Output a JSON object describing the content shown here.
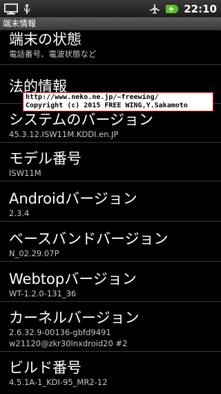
{
  "status_bar": {
    "time": "22:10",
    "icons": [
      "monitor-icon",
      "usb-icon",
      "airplane-icon",
      "battery-charging-icon"
    ]
  },
  "title": "端末情報",
  "items": [
    {
      "title": "端末の状態",
      "subtitle": "電話番号、電波状態など"
    },
    {
      "title": "法的情報",
      "subtitle": ""
    },
    {
      "title": "システムのバージョン",
      "subtitle": "45.3.12.ISW11M.KDDI.en.JP"
    },
    {
      "title": "モデル番号",
      "subtitle": "ISW11M"
    },
    {
      "title": "Androidバージョン",
      "subtitle": "2.3.4"
    },
    {
      "title": "ベースバンドバージョン",
      "subtitle": "N_02.29.07P"
    },
    {
      "title": "Webtopバージョン",
      "subtitle": "WT-1.2.0-131_36"
    },
    {
      "title": "カーネルバージョン",
      "subtitle": "2.6.32.9-00136-gbfd9491",
      "subtitle2": "w21120@zkr30lnxdroid20 #2"
    },
    {
      "title": "ビルド番号",
      "subtitle": "4.5.1A-1_KDI-95_MR2-12"
    }
  ],
  "watermark": {
    "line1": "http://www.neko.ne.jp/~freewing/",
    "line2": "Copyright (c) 2015 FREE WING,Y.Sakamoto"
  },
  "colors": {
    "background": "#000000",
    "title_bar": "#4a4a4a",
    "battery_green": "#58c020",
    "watermark_border": "#e00000"
  }
}
